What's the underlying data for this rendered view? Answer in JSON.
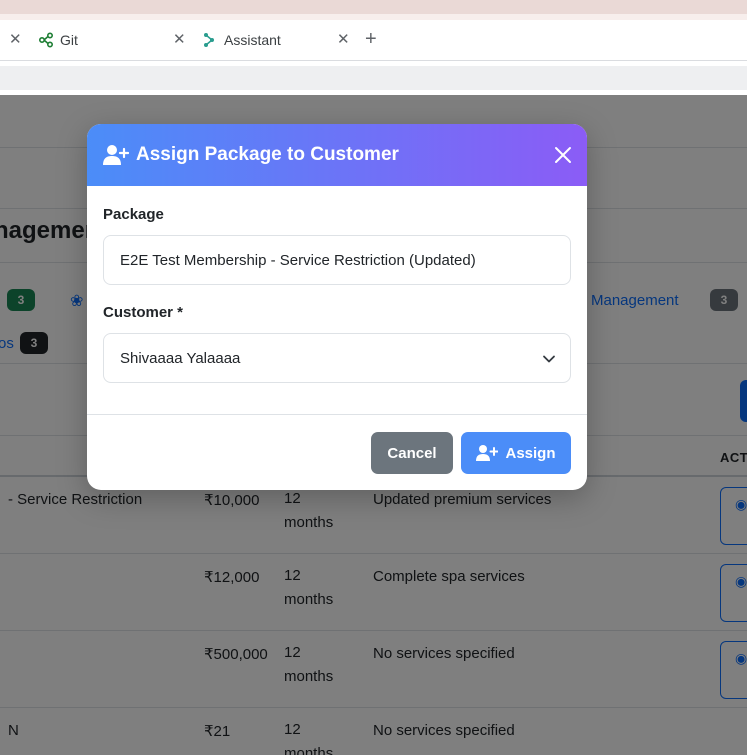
{
  "browser": {
    "tabs": [
      {
        "label": "Git",
        "icon": "git-branch-icon"
      },
      {
        "label": "Assistant",
        "icon": "assistant-icon"
      }
    ],
    "new_tab_symbol": "+"
  },
  "page": {
    "title": "nagement",
    "nav": {
      "left_badge": "3",
      "right_link": "ers Management",
      "right_badge": "3",
      "second_link": "os",
      "second_badge": "3"
    },
    "table": {
      "actions_header": "ACTI",
      "rows": [
        {
          "name": "- Service Restriction",
          "price": "₹10,000",
          "duration": "12 months",
          "description": "Updated premium services"
        },
        {
          "name": "",
          "price": "₹12,000",
          "duration": "12 months",
          "description": "Complete spa services"
        },
        {
          "name": "",
          "price": "₹500,000",
          "duration": "12 months",
          "description": "No services specified"
        },
        {
          "name": "N",
          "price": "₹21",
          "duration": "12 months",
          "description": "No services specified"
        }
      ]
    }
  },
  "modal": {
    "title": "Assign Package to Customer",
    "header_gradient": [
      "#4b8df8",
      "#8b5cf6"
    ],
    "package_label": "Package",
    "package_value": "E2E Test Membership - Service Restriction (Updated)",
    "customer_label": "Customer *",
    "customer_value": "Shivaaaa Yalaaaa",
    "cancel_label": "Cancel",
    "assign_label": "Assign"
  },
  "colors": {
    "primary": "#4b8df8",
    "secondary": "#6c757d",
    "success": "#198754"
  }
}
